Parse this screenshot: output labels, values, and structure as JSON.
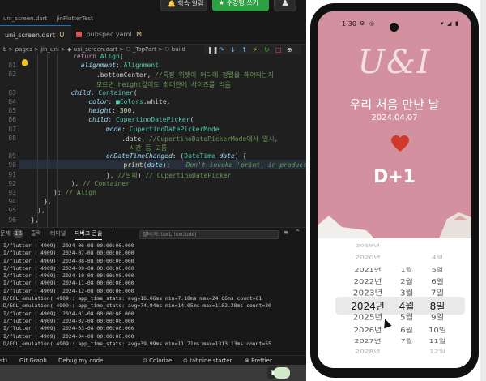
{
  "topbar": {
    "btn_alert": "🔔 학습 알림",
    "btn_request": "★ 수강평 쓰기",
    "avatar": "♟"
  },
  "window_title": "uni_screen.dart — jinFlutterTest",
  "tabs": [
    {
      "label": "uni_screen.dart",
      "badge": "U"
    },
    {
      "label": "pubspec.yaml",
      "badge": "M"
    }
  ],
  "breadcrumb": "b > pages > jin_uni > ◆ uni_screen.dart > ⚇ _TopPart > ⚇ build",
  "code_lines": [
    {
      "n": "",
      "html": "<span class='k'>return</span> <span class='t'>Align</span>("
    },
    {
      "n": "81",
      "html": "  <span class='p'>alignment</span>: <span class='t'>Alignment</span>"
    },
    {
      "n": "82",
      "html": "      .<span class='s'>bottomCenter</span>, <span class='c'>//특정 위젯이 어디에 정렬을 해야되는지</span>"
    },
    {
      "n": "",
      "html": "      <span class='c'>모르면 height값이도 최대한에 사이즈를 먹음</span>"
    },
    {
      "n": "83",
      "html": "  <span class='p'>child</span>: <span class='t'>Container</span>("
    },
    {
      "n": "84",
      "html": "    <span class='p'>color</span>: <span class='t'>■Colors</span>.<span class='s'>white</span>,"
    },
    {
      "n": "85",
      "html": "    <span class='p'>height</span>: <span class='n'>300</span>,"
    },
    {
      "n": "86",
      "html": "    <span class='p'>child</span>: <span class='t'>CupertinoDatePicker</span>("
    },
    {
      "n": "87",
      "html": "      <span class='p'>mode</span>: <span class='t'>CupertinoDatePickerMode</span>"
    },
    {
      "n": "88",
      "html": "          .<span class='s'>date</span>, <span class='c'>//CupertinoDatePickerMode에서 일시,</span>"
    },
    {
      "n": "",
      "html": "          <span class='c'>  시간 등 고름</span>"
    },
    {
      "n": "89",
      "html": "      <span class='p'>onDateTimeChanged</span>: (<span class='t'>DateTime</span> <span class='p'>date</span>) {"
    },
    {
      "n": "90",
      "html": "        <span class='f'>print</span>(<span class='p'>date</span>);    <span class='lens'>Don't invoke 'print' in production</span>"
    },
    {
      "n": "91",
      "html": "      }, <span class='c'>//날짜</span>) <span class='c'>// CupertinoDatePicker</span>"
    },
    {
      "n": "92",
      "html": "  ), <span class='c'>// Container</span>"
    },
    {
      "n": "93",
      "html": "); <span class='c'>// Align</span>"
    },
    {
      "n": "94",
      "html": "},"
    },
    {
      "n": "95",
      "html": "),"
    },
    {
      "n": "96",
      "html": "},"
    }
  ],
  "panel": {
    "tabs": [
      "문제",
      "18",
      "출력",
      "터미널",
      "디버그 콘솔",
      "···"
    ],
    "filter_placeholder": "필터(예: text, !exclude)",
    "lines": [
      "I/flutter ( 4909): 2024-06-08 00:00:00.000",
      "I/flutter ( 4909): 2024-07-08 00:00:00.000",
      "I/flutter ( 4909): 2024-08-08 00:00:00.000",
      "I/flutter ( 4909): 2024-09-08 00:00:00.000",
      "I/flutter ( 4909): 2024-10-08 00:00:00.000",
      "I/flutter ( 4909): 2024-11-08 00:00:00.000",
      "I/flutter ( 4909): 2024-12-08 00:00:00.000",
      "D/EGL_emulation( 4909): app_time_stats: avg=16.06ms min=7.18ms max=24.66ms count=61",
      "D/EGL_emulation( 4909): app_time_stats: avg=74.94ms min=14.05ms max=1182.28ms count=20",
      "I/flutter ( 4909): 2024-01-08 00:00:00.000",
      "I/flutter ( 4909): 2024-02-08 00:00:00.000",
      "I/flutter ( 4909): 2024-03-08 00:00:00.000",
      "I/flutter ( 4909): 2024-04-08 00:00:00.000",
      "D/EGL_emulation( 4909): app_time_stats: avg=39.99ms min=11.71ms max=1313.13ms count=55"
    ]
  },
  "statusbar": {
    "left": "st)",
    "git": "Git Graph",
    "debug": "Debug my code",
    "colorize": "⊙ Colorize",
    "tabnine": "⊙ tabnine starter",
    "prettier": "⊗ Prettier"
  },
  "phone": {
    "time": "1:30",
    "logo": "U&I",
    "subtitle": "우리 처음 만난 날",
    "date": "2024.04.07",
    "dday": "D+1",
    "heart_color": "#d0392b",
    "bg_color": "#d3919f",
    "picker": {
      "years": [
        "2019년",
        "2020년",
        "2021년",
        "2022년",
        "2023년",
        "2024년",
        "2025년",
        "2026년",
        "2027년",
        "2028년"
      ],
      "months": [
        "1월",
        "2월",
        "3월",
        "4월",
        "5월",
        "6월",
        "7월"
      ],
      "days": [
        "4일",
        "5일",
        "6일",
        "7일",
        "8일",
        "9일",
        "10일",
        "11일",
        "12일"
      ],
      "selected": {
        "year": "2024년",
        "month": "4월",
        "day": "8일"
      }
    }
  }
}
